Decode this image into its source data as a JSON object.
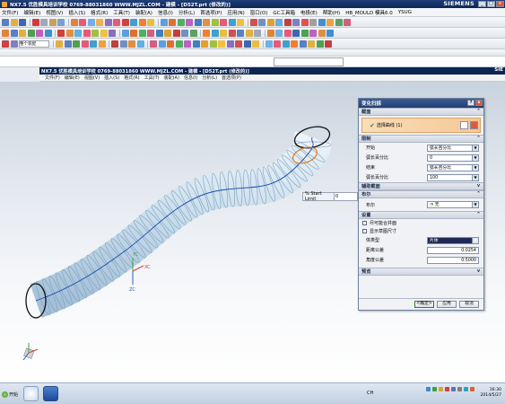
{
  "window": {
    "title": "NX7.5  优胜模具培训学校  0769-88031860  WWW.MJZL.COM  - 建模 - [D52T.prt  (修改的)]",
    "brand": "SIEMENS",
    "btn_min": "_",
    "btn_max": "□",
    "btn_close": "x"
  },
  "menubar": {
    "items": [
      "文件(F)",
      "编辑(E)",
      "视图(V)",
      "插入(S)",
      "格式(R)",
      "工具(T)",
      "装配(A)",
      "信息(I)",
      "分析(L)",
      "首选项(P)",
      "应用(N)",
      "窗口(O)",
      "GC工具箱",
      "电极(E)",
      "帮助(H)",
      "HB_MOULD 模具6.0",
      "YSUG"
    ]
  },
  "toolbar3": {
    "select_label": "整个装配"
  },
  "window2": {
    "title": "NX7.5  优胜模具培训学校  0769-88031860  WWW.MJZL.COM  - 建模 - [D52T.prt  (修改的)]",
    "brand": "SIE",
    "menu_items": [
      "文件(F)",
      "编辑(E)",
      "视图(V)",
      "插入(S)",
      "格式(R)",
      "工具(T)",
      "装配(A)",
      "信息(I)",
      "分析(L)",
      "首选项(P)"
    ]
  },
  "viewport": {
    "start_limit_label": "% Start Limit",
    "start_limit_value": "0",
    "axis_x": "XC",
    "axis_y": "YC",
    "axis_z": "ZC"
  },
  "dialog": {
    "title": "变化扫掠",
    "btn_help": "?",
    "btn_close": "x",
    "sections": {
      "cross_section": "截面",
      "limits": "限制",
      "aux_section": "辅助截面",
      "boolean": "布尔",
      "settings": "设置",
      "preview": "预览"
    },
    "select_curve": "选择曲线 (1)",
    "limits": {
      "start_label": "开始",
      "start_value": "弧长百分比",
      "start_pct_label": "弧长百分比",
      "start_pct_value": "0",
      "end_label": "结束",
      "end_value": "弧长百分比",
      "end_pct_label": "弧长百分比",
      "end_pct_value": "100"
    },
    "boolean": {
      "label": "布尔",
      "value": "无"
    },
    "settings": {
      "check1": "尽可能合并面",
      "check2": "显示草图尺寸",
      "body_type_label": "体类型",
      "body_type_value": "片体",
      "dist_tol_label": "距离公差",
      "dist_tol_value": "0.0254",
      "angle_tol_label": "角度公差",
      "angle_tol_value": "0.5000"
    },
    "buttons": {
      "ok": "<确定>",
      "apply": "应用",
      "cancel": "取消"
    }
  },
  "taskbar": {
    "start_label": "开始",
    "lang": "CH",
    "time": "16:30",
    "date": "2014/5/27"
  }
}
